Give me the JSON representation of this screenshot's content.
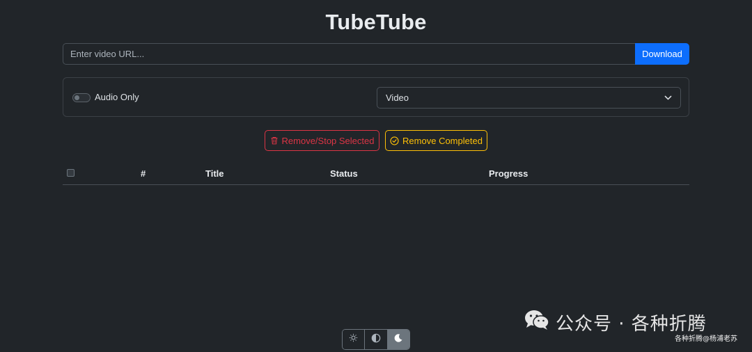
{
  "app": {
    "title": "TubeTube"
  },
  "url_bar": {
    "placeholder": "Enter video URL...",
    "value": "",
    "download_label": "Download"
  },
  "options": {
    "audio_only_label": "Audio Only",
    "audio_only_checked": false,
    "format_selected": "Video"
  },
  "actions": {
    "remove_stop_label": "Remove/Stop Selected",
    "remove_completed_label": "Remove Completed"
  },
  "table": {
    "columns": [
      "#",
      "Title",
      "Status",
      "Progress"
    ],
    "rows": []
  },
  "theme": {
    "options": [
      "light",
      "auto",
      "dark"
    ],
    "active": "dark"
  },
  "watermark": {
    "main": "公众号 · 各种折腾",
    "sub": "各种折腾@杨浦老苏"
  },
  "colors": {
    "background": "#212529",
    "primary": "#0d6efd",
    "danger": "#dc3545",
    "warning": "#ffc107"
  },
  "icons": {
    "remove_stop": "trash-icon",
    "remove_completed": "check-circle-icon",
    "format_select": "chevron-down-icon",
    "theme_light": "sun-icon",
    "theme_auto": "half-circle-icon",
    "theme_dark": "moon-icon",
    "watermark": "wechat-icon"
  }
}
